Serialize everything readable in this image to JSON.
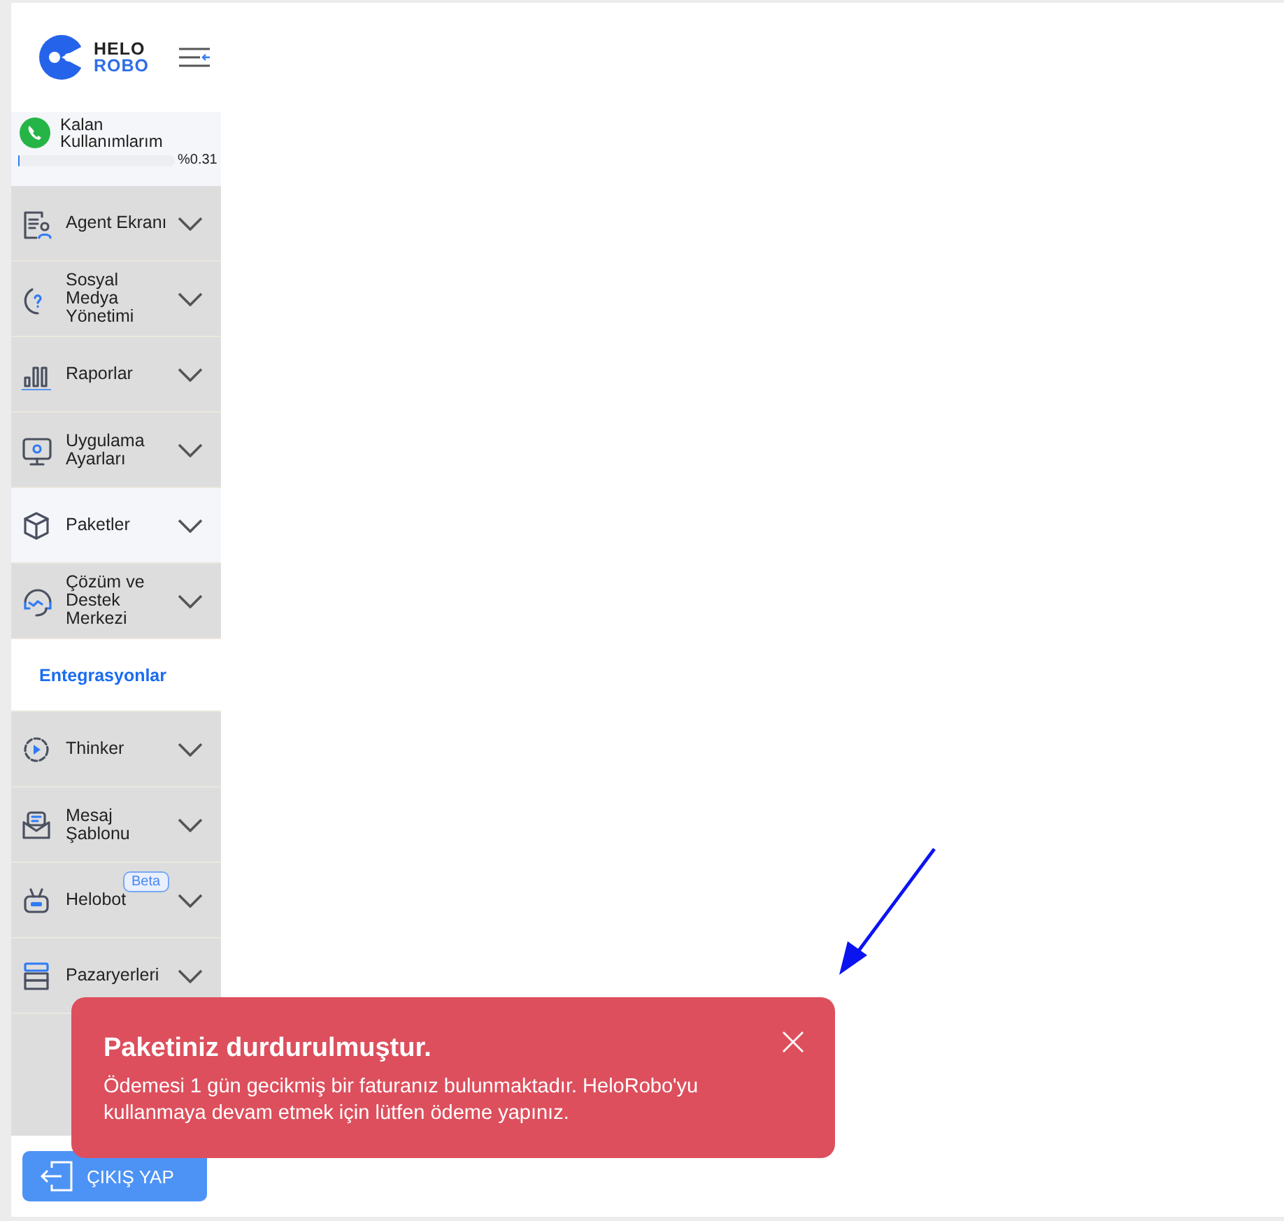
{
  "logo": {
    "line1": "HELO",
    "line2": "ROBO"
  },
  "usage": {
    "title": "Kalan Kullanımlarım",
    "level": 0.0031,
    "reading": "%0.31"
  },
  "menu": [
    {
      "kind": "group",
      "label": "Agent Ekranı",
      "selected": false,
      "hovered": false
    },
    {
      "kind": "group",
      "label": "Sosyal Medya Yönetimi",
      "selected": false,
      "hovered": false
    },
    {
      "kind": "group",
      "label": "Raporlar",
      "selected": false,
      "hovered": false
    },
    {
      "kind": "group",
      "label": "Uygulama Ayarları",
      "selected": false,
      "hovered": false
    },
    {
      "kind": "group",
      "label": "Paketler",
      "selected": false,
      "hovered": true
    },
    {
      "kind": "group",
      "label": "Çözüm ve Destek Merkezi",
      "selected": false,
      "hovered": false
    },
    {
      "kind": "link",
      "label": "Entegrasyonlar",
      "selected": true,
      "hovered": false
    },
    {
      "kind": "group",
      "label": "Thinker",
      "selected": false,
      "hovered": false
    },
    {
      "kind": "group",
      "label": "Mesaj Şablonu",
      "selected": false,
      "hovered": false
    },
    {
      "kind": "group",
      "label": "Helobot",
      "badge": "Beta",
      "selected": false,
      "hovered": false
    },
    {
      "kind": "group",
      "label": "Pazaryerleri",
      "selected": false,
      "hovered": false
    }
  ],
  "logout_button": "ÇIKIŞ YAP",
  "toast": {
    "title": "Paketiniz durdurulmuştur.",
    "message": "Ödemesi 1 gün gecikmiş bir faturanız bulunmaktadır. HeloRobo'yu kullanmaya devam etmek için lütfen ödeme yapınız."
  }
}
